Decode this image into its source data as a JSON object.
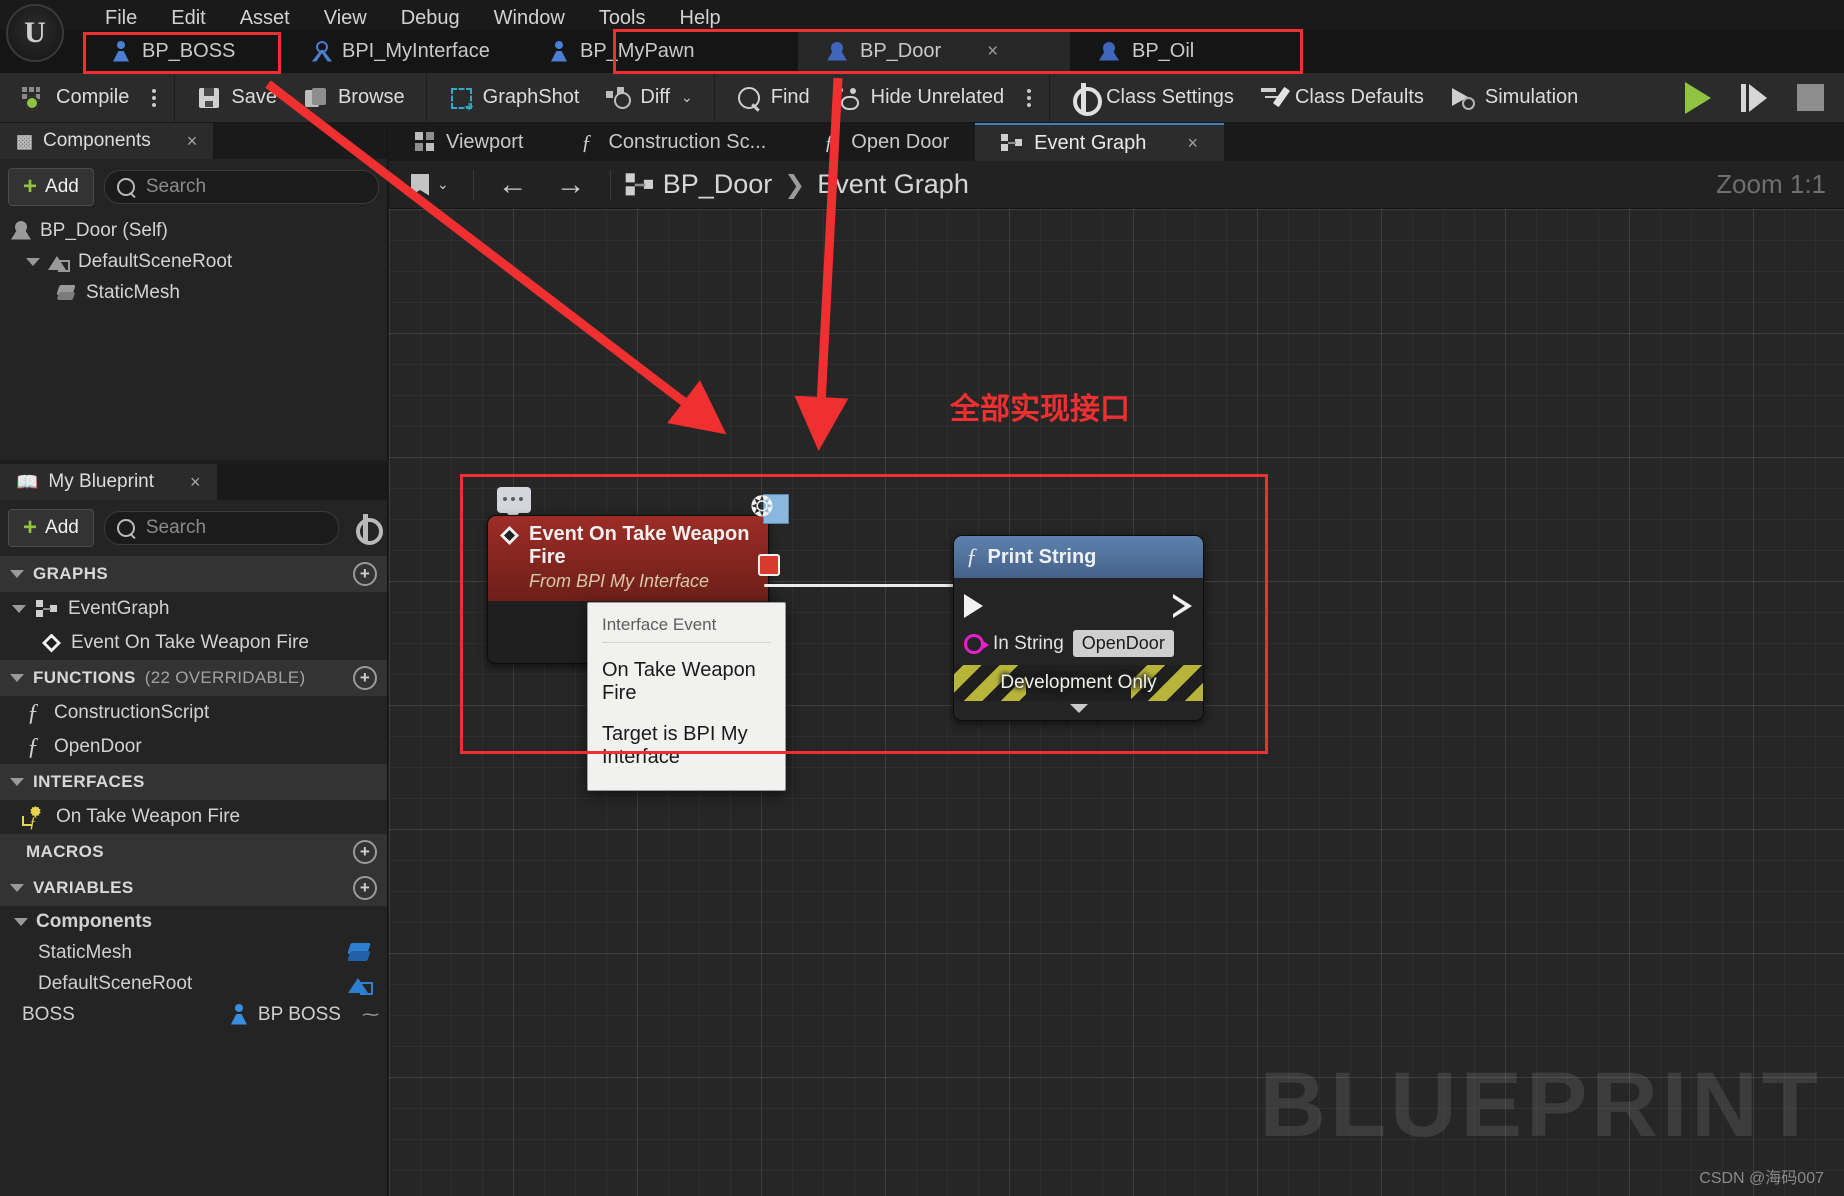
{
  "menu": {
    "items": [
      "File",
      "Edit",
      "Asset",
      "View",
      "Debug",
      "Window",
      "Tools",
      "Help"
    ]
  },
  "asset_tabs": [
    {
      "label": "BP_BOSS",
      "icon": "pawn-icon",
      "active": false,
      "closable": false
    },
    {
      "label": "BPI_MyInterface",
      "icon": "interface-icon",
      "active": false,
      "closable": false
    },
    {
      "label": "BP_MyPawn",
      "icon": "pawn-icon",
      "active": false,
      "closable": false
    },
    {
      "label": "BP_Door",
      "icon": "door-icon",
      "active": true,
      "closable": true,
      "close": "×"
    },
    {
      "label": "BP_Oil",
      "icon": "door-icon",
      "active": false,
      "closable": false
    }
  ],
  "toolbar": {
    "compile": "Compile",
    "save": "Save",
    "browse": "Browse",
    "graphshot": "GraphShot",
    "diff": "Diff",
    "diff_chevron": "⌄",
    "find": "Find",
    "hide_unrelated": "Hide Unrelated",
    "class_settings": "Class Settings",
    "class_defaults": "Class Defaults",
    "simulation": "Simulation"
  },
  "components_panel": {
    "tab_title": "Components",
    "tab_close": "×",
    "add_label": "Add",
    "search_placeholder": "Search",
    "tree": [
      {
        "label": "BP_Door (Self)",
        "indent": 0,
        "icon": "actor-icon",
        "expander": false
      },
      {
        "label": "DefaultSceneRoot",
        "indent": 1,
        "icon": "scene-root-icon",
        "expander": true
      },
      {
        "label": "StaticMesh",
        "indent": 2,
        "icon": "static-mesh-icon",
        "expander": false
      }
    ]
  },
  "my_blueprint_panel": {
    "tab_title": "My Blueprint",
    "tab_close": "×",
    "add_label": "Add",
    "search_placeholder": "Search",
    "sections": [
      {
        "title": "GRAPHS",
        "sub": "",
        "has_plus": true,
        "items": [
          {
            "label": "EventGraph",
            "icon": "graph-icon",
            "expander": true,
            "indent": 0
          },
          {
            "label": "Event On Take Weapon Fire",
            "icon": "event-diamond-icon",
            "expander": false,
            "indent": 1
          }
        ]
      },
      {
        "title": "FUNCTIONS",
        "sub": "(22 OVERRIDABLE)",
        "has_plus": true,
        "items": [
          {
            "label": "ConstructionScript",
            "icon": "construction-fn-icon",
            "expander": false,
            "indent": 0
          },
          {
            "label": "OpenDoor",
            "icon": "function-icon",
            "expander": false,
            "indent": 0
          }
        ]
      },
      {
        "title": "INTERFACES",
        "sub": "",
        "has_plus": false,
        "items": [
          {
            "label": "On Take Weapon Fire",
            "icon": "interface-fn-icon",
            "expander": false,
            "indent": 0
          }
        ]
      },
      {
        "title": "MACROS",
        "sub": "",
        "has_plus": true,
        "items": []
      },
      {
        "title": "VARIABLES",
        "sub": "",
        "has_plus": true,
        "items": []
      }
    ],
    "variables_group": {
      "group_label": "Components",
      "rows": [
        {
          "name": "StaticMesh",
          "type": "StaticMesh",
          "type_icon": "static-mesh-type-icon",
          "type_text": ""
        },
        {
          "name": "DefaultSceneRoot",
          "type": "SceneComponent",
          "type_icon": "scene-root-type-icon",
          "type_text": ""
        },
        {
          "name": "BOSS",
          "type": "BP BOSS",
          "type_icon": "pawn-type-icon",
          "type_text": "BP BOSS",
          "eye": "⁓"
        }
      ]
    }
  },
  "graph_tabs": [
    {
      "label": "Viewport",
      "icon": "viewport-icon",
      "active": false,
      "closable": false
    },
    {
      "label": "Construction Sc...",
      "icon": "function-icon",
      "active": false,
      "closable": false
    },
    {
      "label": "Open Door",
      "icon": "function-icon",
      "active": false,
      "closable": false
    },
    {
      "label": "Event Graph",
      "icon": "graph-icon",
      "active": true,
      "closable": true,
      "close": "×"
    }
  ],
  "graph_toolbar": {
    "back_arrow": "←",
    "forward_arrow": "→",
    "bookmark_chevron": "⌄",
    "breadcrumb_root": "BP_Door",
    "breadcrumb_sep": "❯",
    "breadcrumb_current": "Event Graph",
    "zoom_label": "Zoom 1:1"
  },
  "graph": {
    "watermark": "BLUEPRINT",
    "credit": "CSDN @海码007",
    "annotation_text": "全部实现接口",
    "annotation_color": "#f03030",
    "event_node": {
      "title": "Event On Take Weapon Fire",
      "subtitle": "From BPI My Interface"
    },
    "print_node": {
      "title": "Print String",
      "in_string_label": "In String",
      "in_string_value": "OpenDoor",
      "dev_only": "Development Only",
      "collapse_chevron": "⌄"
    },
    "tooltip": {
      "header": "Interface Event",
      "line1": "On Take Weapon Fire",
      "line2": "Target is BPI My Interface"
    }
  }
}
